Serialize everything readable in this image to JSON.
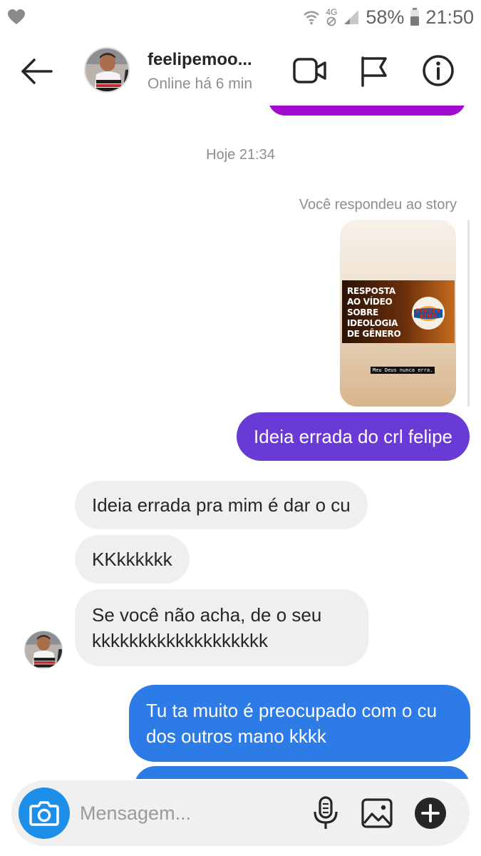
{
  "status_bar": {
    "network": "4G",
    "battery": "58%",
    "time": "21:50"
  },
  "header": {
    "username": "feelipemoo...",
    "presence": "Online há 6 min",
    "icons": [
      "back-arrow-icon",
      "video-camera-icon",
      "flag-icon",
      "info-icon"
    ]
  },
  "chat": {
    "date_separator": "Hoje 21:34",
    "story_reply_note": "Você respondeu ao story",
    "story": {
      "video_text": "RESPOSTA AO VÍDEO SOBRE IDEOLOGIA DE GÊNERO",
      "logo_text": [
        "BURGER",
        "KING"
      ],
      "caption": "Meu Deus nunca erra."
    },
    "messages": [
      {
        "from": "me",
        "text": "Ideia errada do crl felipe"
      },
      {
        "from": "them",
        "text": "Ideia errada pra mim é dar o cu"
      },
      {
        "from": "them",
        "text": "KKkkkkkk"
      },
      {
        "from": "them",
        "text": "Se você não acha, de o seu kkkkkkkkkkkkkkkkkkk"
      },
      {
        "from": "me",
        "text": "Tu ta muito é preocupado com o cu dos outros mano kkkk"
      }
    ]
  },
  "composer": {
    "placeholder": "Mensagem...",
    "icons": [
      "camera-icon",
      "microphone-icon",
      "gallery-icon",
      "add-icon"
    ]
  },
  "colors": {
    "outgoing_purple": "#6a3ad6",
    "outgoing_blue": "#2d7be6",
    "incoming_gray": "#efefef",
    "camera_blue": "#1d8fe8"
  }
}
